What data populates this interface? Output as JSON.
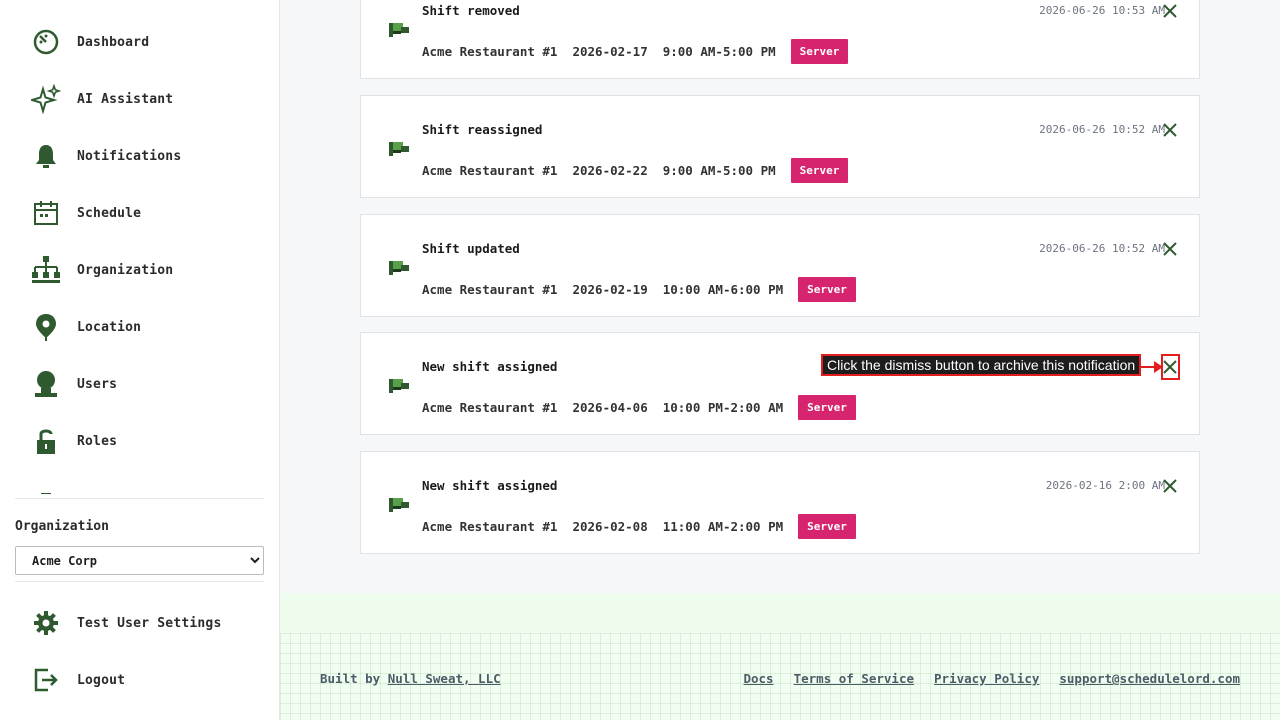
{
  "sidebar": {
    "items": [
      {
        "label": "Dashboard",
        "icon": "dashboard-icon"
      },
      {
        "label": "AI Assistant",
        "icon": "sparkle-icon"
      },
      {
        "label": "Notifications",
        "icon": "bell-icon"
      },
      {
        "label": "Schedule",
        "icon": "calendar-icon"
      },
      {
        "label": "Organization",
        "icon": "org-chart-icon"
      },
      {
        "label": "Location",
        "icon": "location-pin-icon"
      },
      {
        "label": "Users",
        "icon": "user-icon"
      },
      {
        "label": "Roles",
        "icon": "unlock-icon"
      }
    ],
    "org_label": "Organization",
    "org_selected": "Acme Corp",
    "bottom": [
      {
        "label": "Test User Settings",
        "icon": "gear-icon"
      },
      {
        "label": "Logout",
        "icon": "logout-icon"
      }
    ]
  },
  "notifications": [
    {
      "title": "Shift removed",
      "location": "Acme Restaurant #1",
      "date": "2026-02-17",
      "time_range": "9:00 AM-5:00 PM",
      "role": "Server",
      "timestamp": "2026-06-26 10:53 AM"
    },
    {
      "title": "Shift reassigned",
      "location": "Acme Restaurant #1",
      "date": "2026-02-22",
      "time_range": "9:00 AM-5:00 PM",
      "role": "Server",
      "timestamp": "2026-06-26 10:52 AM"
    },
    {
      "title": "Shift updated",
      "location": "Acme Restaurant #1",
      "date": "2026-02-19",
      "time_range": "10:00 AM-6:00 PM",
      "role": "Server",
      "timestamp": "2026-06-26 10:52 AM"
    },
    {
      "title": "New shift assigned",
      "location": "Acme Restaurant #1",
      "date": "2026-04-06",
      "time_range": "10:00 PM-2:00 AM",
      "role": "Server",
      "timestamp": ""
    },
    {
      "title": "New shift assigned",
      "location": "Acme Restaurant #1",
      "date": "2026-02-08",
      "time_range": "11:00 AM-2:00 PM",
      "role": "Server",
      "timestamp": "2026-02-16 2:00 AM"
    }
  ],
  "hint": {
    "text": "Click the dismiss button to archive this notification"
  },
  "footer": {
    "built_by_prefix": "Built by",
    "built_by_link": "Null Sweat, LLC",
    "links": [
      "Docs",
      "Terms of Service",
      "Privacy Policy",
      "support@schedulelord.com"
    ]
  },
  "colors": {
    "accent": "#2f5a2f",
    "badge": "#d6246e",
    "highlight": "#e11d1d"
  }
}
